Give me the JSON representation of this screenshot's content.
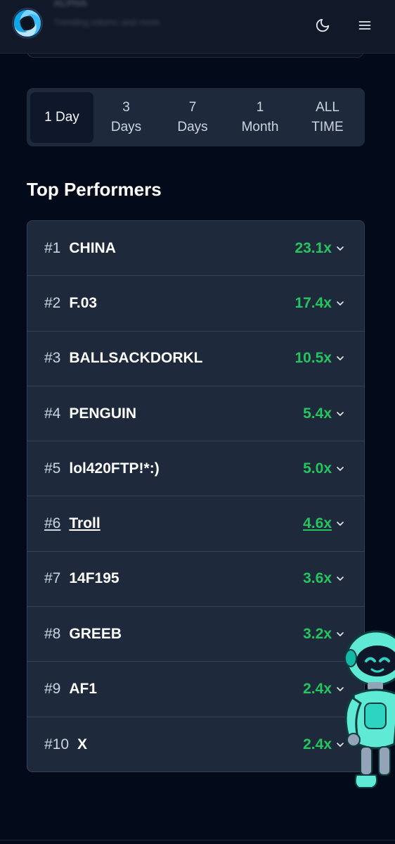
{
  "header": {
    "title_blurred": "ALPHA",
    "subtitle_blurred": "Trending tokens and more",
    "icons": {
      "logo": "swirl-logo-icon",
      "theme": "moon-icon",
      "menu": "hamburger-menu-icon"
    }
  },
  "time_tabs": [
    {
      "label": "1 Day",
      "active": true
    },
    {
      "label": "3\nDays",
      "active": false
    },
    {
      "label": "7\nDays",
      "active": false
    },
    {
      "label": "1\nMonth",
      "active": false
    },
    {
      "label": "ALL\nTIME",
      "active": false
    }
  ],
  "section_title": "Top Performers",
  "performers": [
    {
      "rank": "#1",
      "name": "CHINA",
      "multiplier": "23.1x"
    },
    {
      "rank": "#2",
      "name": "F.03",
      "multiplier": "17.4x"
    },
    {
      "rank": "#3",
      "name": "BALLSACKDORKL",
      "multiplier": "10.5x"
    },
    {
      "rank": "#4",
      "name": "PENGUIN",
      "multiplier": "5.4x"
    },
    {
      "rank": "#5",
      "name": "lol420FTP!*:)",
      "multiplier": "5.0x"
    },
    {
      "rank": "#6",
      "name": "Troll",
      "multiplier": "4.6x",
      "hovered": true
    },
    {
      "rank": "#7",
      "name": "14F195",
      "multiplier": "3.6x"
    },
    {
      "rank": "#8",
      "name": "GREEB",
      "multiplier": "3.2x"
    },
    {
      "rank": "#9",
      "name": "AF1",
      "multiplier": "2.4x"
    },
    {
      "rank": "#10",
      "name": "X",
      "multiplier": "2.4x"
    }
  ],
  "colors": {
    "accent_green": "#22c55e",
    "card": "#1e293b",
    "background": "#030b1a"
  }
}
